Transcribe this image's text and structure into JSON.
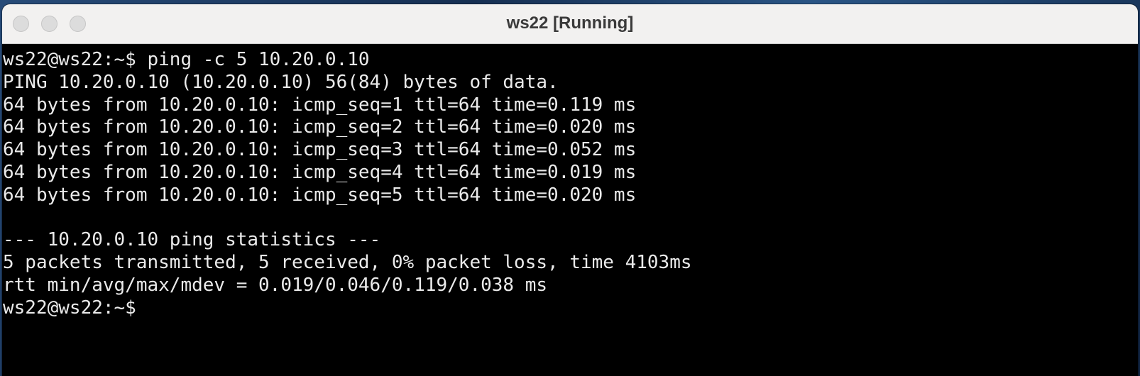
{
  "window": {
    "title": "ws22 [Running]"
  },
  "terminal": {
    "lines": [
      "ws22@ws22:~$ ping -c 5 10.20.0.10",
      "PING 10.20.0.10 (10.20.0.10) 56(84) bytes of data.",
      "64 bytes from 10.20.0.10: icmp_seq=1 ttl=64 time=0.119 ms",
      "64 bytes from 10.20.0.10: icmp_seq=2 ttl=64 time=0.020 ms",
      "64 bytes from 10.20.0.10: icmp_seq=3 ttl=64 time=0.052 ms",
      "64 bytes from 10.20.0.10: icmp_seq=4 ttl=64 time=0.019 ms",
      "64 bytes from 10.20.0.10: icmp_seq=5 ttl=64 time=0.020 ms",
      "",
      "--- 10.20.0.10 ping statistics ---",
      "5 packets transmitted, 5 received, 0% packet loss, time 4103ms",
      "rtt min/avg/max/mdev = 0.019/0.046/0.119/0.038 ms",
      "ws22@ws22:~$"
    ]
  },
  "colors": {
    "terminal_background": "#000000",
    "terminal_text": "#eaeaea",
    "titlebar_background": "#f2f1f0"
  }
}
